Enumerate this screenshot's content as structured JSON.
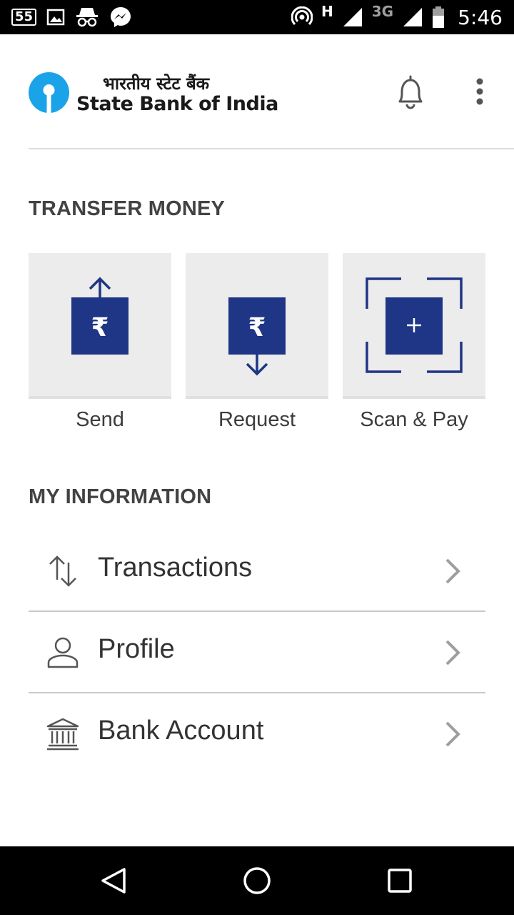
{
  "status_bar": {
    "notification_count": "55",
    "network_primary": "H",
    "network_secondary": "3G",
    "time": "5:46",
    "icons": [
      "notification-count-icon",
      "image-icon",
      "incognito-icon",
      "messenger-icon",
      "hotspot-icon",
      "signal-icon",
      "signal-icon",
      "battery-icon"
    ]
  },
  "header": {
    "logo_hindi": "भारतीय स्टेट बैंक",
    "logo_english": "State Bank of India",
    "brand_color": "#1aa3e8",
    "icons": [
      "sbi-logo-icon",
      "bell-icon",
      "more-vert-icon"
    ]
  },
  "transfer": {
    "title": "TRANSFER MONEY",
    "tiles": [
      {
        "label": "Send",
        "icon": "send-money-icon"
      },
      {
        "label": "Request",
        "icon": "request-money-icon"
      },
      {
        "label": "Scan & Pay",
        "icon": "scan-pay-icon"
      }
    ],
    "accent_color": "#1f3585"
  },
  "info": {
    "title": "MY INFORMATION",
    "items": [
      {
        "label": "Transactions",
        "icon": "transactions-icon"
      },
      {
        "label": "Profile",
        "icon": "person-icon"
      },
      {
        "label": "Bank Account",
        "icon": "bank-icon"
      }
    ]
  },
  "nav_bar": {
    "icons": [
      "back-icon",
      "home-icon",
      "recents-icon"
    ]
  }
}
